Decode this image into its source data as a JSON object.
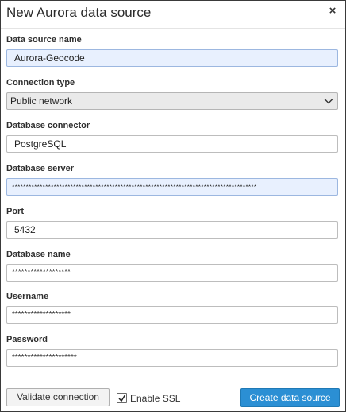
{
  "dialog": {
    "title": "New Aurora data source",
    "close_icon": "×"
  },
  "fields": {
    "data_source_name": {
      "label": "Data source name",
      "value": "Aurora-Geocode"
    },
    "connection_type": {
      "label": "Connection type",
      "value": "Public network",
      "icon": "chevron-down-icon"
    },
    "database_connector": {
      "label": "Database connector",
      "value": "PostgreSQL"
    },
    "database_server": {
      "label": "Database server",
      "value": "****************************************************************************************"
    },
    "port": {
      "label": "Port",
      "value": "5432"
    },
    "database_name": {
      "label": "Database name",
      "value": "*******************"
    },
    "username": {
      "label": "Username",
      "value": "*******************"
    },
    "password": {
      "label": "Password",
      "value": "*********************"
    }
  },
  "footer": {
    "validate_label": "Validate connection",
    "ssl_label": "Enable SSL",
    "ssl_checked": true,
    "create_label": "Create data source"
  },
  "colors": {
    "primary_button": "#2b8fd4",
    "autofill_background": "#e8f0fe",
    "select_background": "#eaeaea"
  }
}
